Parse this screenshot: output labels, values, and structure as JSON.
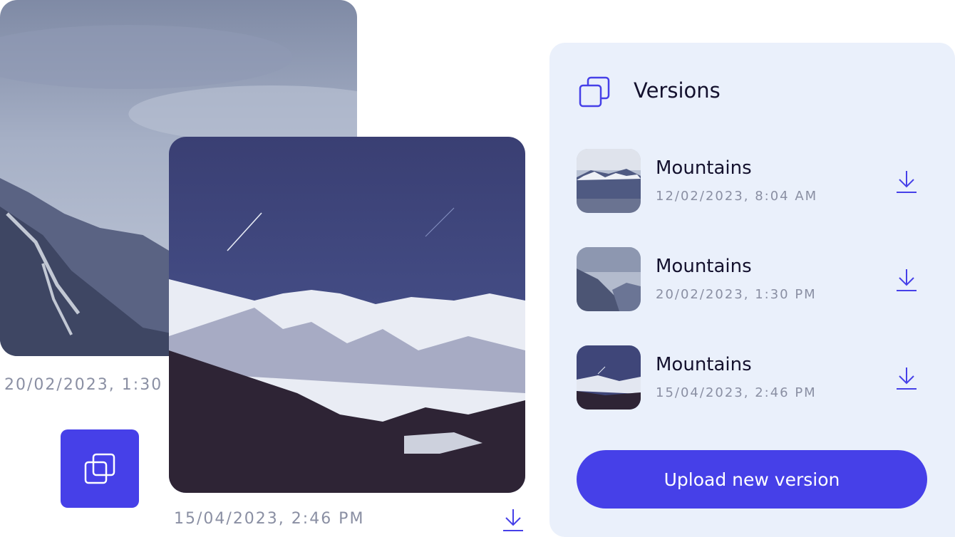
{
  "back_photo": {
    "timestamp": "20/02/2023, 1:30"
  },
  "front_photo": {
    "timestamp": "15/04/2023, 2:46 PM",
    "download_icon": "download-icon"
  },
  "copy_tile": {
    "icon": "copy-icon"
  },
  "panel": {
    "title": "Versions",
    "header_icon": "copy-icon",
    "versions": [
      {
        "name": "Mountains",
        "date": "12/02/2023, 8:04 AM",
        "icon": "download-icon"
      },
      {
        "name": "Mountains",
        "date": "20/02/2023, 1:30 PM",
        "icon": "download-icon"
      },
      {
        "name": "Mountains",
        "date": "15/04/2023, 2:46 PM",
        "icon": "download-icon"
      }
    ],
    "upload_label": "Upload new version"
  },
  "colors": {
    "accent": "#4640e8",
    "panel_bg": "#eaf0fb",
    "muted_text": "#8a8fa3",
    "title_text": "#14112e"
  }
}
